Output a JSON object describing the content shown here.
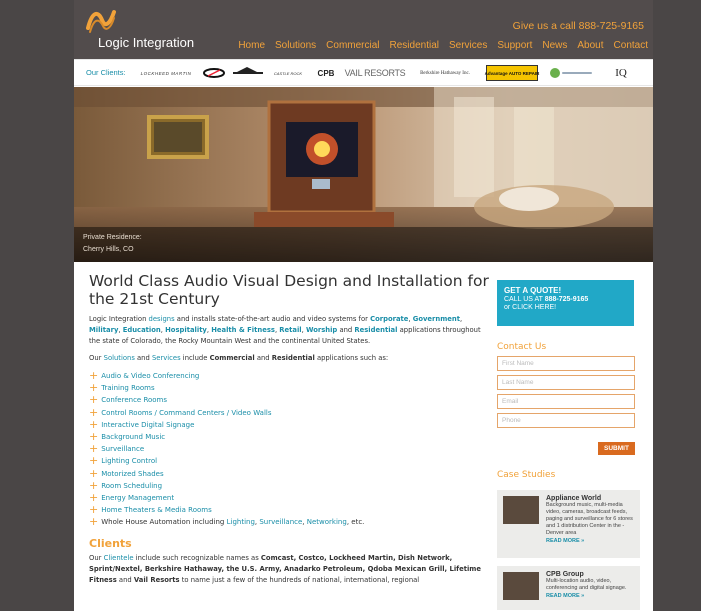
{
  "header": {
    "logo_text": "Logic Integration",
    "callout": "Give us a call 888-725-9165",
    "nav": [
      "Home",
      "Solutions",
      "Commercial",
      "Residential",
      "Services",
      "Support",
      "News",
      "About",
      "Contact"
    ]
  },
  "clients_bar": {
    "label": "Our Clients:",
    "logos": [
      "LOCKHEED MARTIN",
      "DISH",
      "ANADARKO",
      "CASTLE ROCK",
      "CPB",
      "VAIL RESORTS",
      "Berkshire Hathaway Inc.",
      "Advantage AUTO REPAIR",
      "SPRINT",
      "IQ"
    ]
  },
  "hero": {
    "caption_line1": "Private Residence:",
    "caption_line2": "Cherry Hills, CO"
  },
  "main": {
    "title": "World Class Audio Visual Design and Installation for the 21st Century",
    "p1": {
      "a": "Logic Integration ",
      "designs": "designs",
      "b": " and installs state-of-the-art audio and video systems for ",
      "corporate": "Corporate",
      "government": "Government",
      "military": "Military",
      "education": "Education",
      "hospitality": "Hospitality",
      "health": "Health & Fitness",
      "retail": "Retail",
      "worship": "Worship",
      "and": " and ",
      "residential": "Residential",
      "c": " applications throughout the state of Colorado, the Rocky Mountain West and the continental United States."
    },
    "p2": {
      "a": "Our ",
      "solutions": "Solutions",
      "and1": " and ",
      "services": "Services",
      "b": " include ",
      "commercial": "Commercial",
      "and2": " and ",
      "residential": "Residential",
      "c": " applications such as:"
    },
    "services": [
      "Audio & Video Conferencing",
      "Training Rooms",
      "Conference Rooms",
      "Control Rooms / Command Centers / Video Walls",
      "Interactive Digital Signage",
      "Background Music",
      "Surveillance",
      "Lighting Control",
      "Motorized Shades",
      "Room Scheduling",
      "Energy Management",
      "Home Theaters & Media Rooms"
    ],
    "last_service": {
      "a": "Whole House Automation including ",
      "lighting": "Lighting",
      "surveillance": "Surveillance",
      "networking": "Networking",
      "b": ", etc."
    },
    "clients_heading": "Clients",
    "clients_para": {
      "a": "Our ",
      "clientele": "Clientele",
      "b": " include such recognizable names as ",
      "names": "Comcast, Costco, Lockheed Martin, Dish Network, Sprint/Nextel, Berkshire Hathaway, the U.S. Army, Anadarko Petroleum, Qdoba Mexican Grill, Lifetime Fitness",
      "and": " and ",
      "vail": "Vail Resorts",
      "c": " to name just a few of the hundreds of national, international, regional"
    }
  },
  "sidebar": {
    "quote_title": "GET A QUOTE!",
    "quote_call_prefix": "CALL US AT ",
    "quote_phone": "888-725-9165",
    "quote_click": "or CLICK HERE!",
    "contact_heading": "Contact Us",
    "fields": [
      "First Name",
      "Last Name",
      "Email",
      "Phone"
    ],
    "submit": "SUBMIT",
    "case_heading": "Case Studies",
    "cases": [
      {
        "title": "Appliance World",
        "desc": "Background music, multi-media video, cameras, broadcast feeds, paging and surveillance for 6 stores and 1 distribution Center in the - Denver area",
        "more": "READ MORE »"
      },
      {
        "title": "CPB Group",
        "desc": "Multi-location audio, video, conferencing and digital signage.",
        "more": "READ MORE »"
      }
    ]
  },
  "colors": {
    "orange": "#f1a23a",
    "teal": "#1a8ea8",
    "quote_bg": "#21a8c7",
    "header_bg": "#524c4c",
    "page_bg": "#4a4646"
  }
}
